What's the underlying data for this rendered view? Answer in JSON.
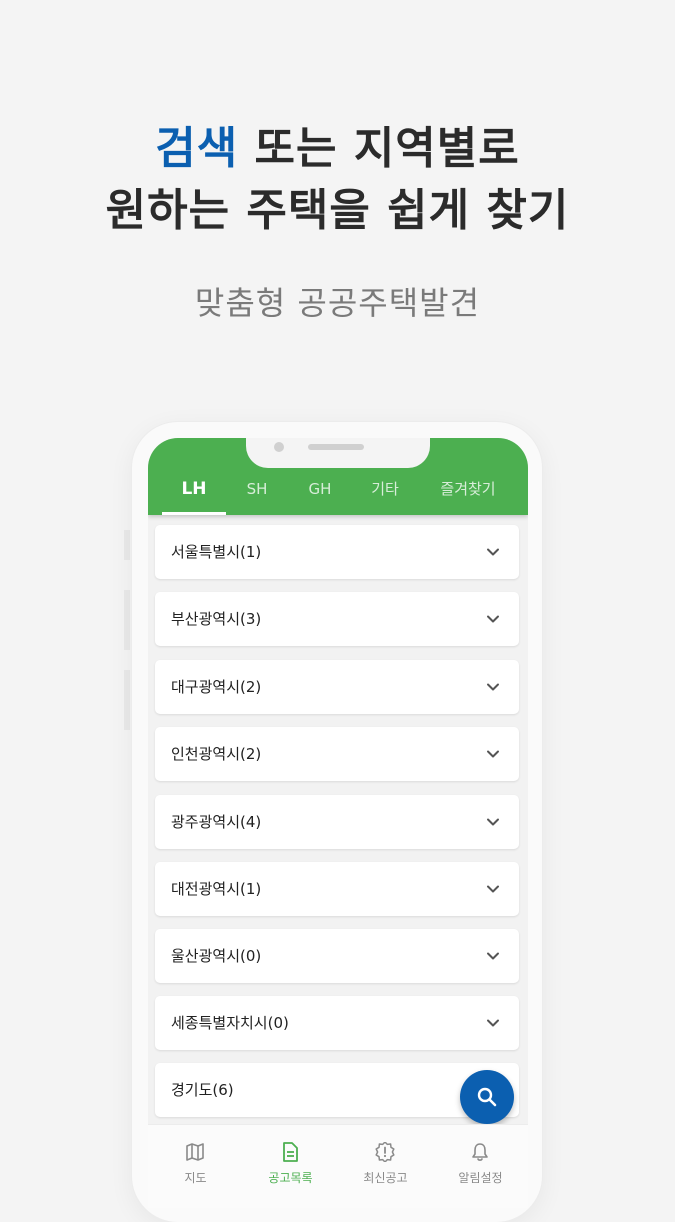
{
  "headline": {
    "line1_highlight": "검색",
    "line1_rest": " 또는 지역별로",
    "line2": "원하는 주택을 쉽게 찾기"
  },
  "subheadline": "맞춤형 공공주택발견",
  "colors": {
    "accent_green": "#4caf50",
    "accent_blue": "#0b5fb0"
  },
  "tabs": [
    {
      "label": "LH",
      "active": true
    },
    {
      "label": "SH",
      "active": false
    },
    {
      "label": "GH",
      "active": false
    },
    {
      "label": "기타",
      "active": false
    },
    {
      "label": "즐겨찾기",
      "active": false
    }
  ],
  "regions": [
    {
      "label": "서울특별시(1)"
    },
    {
      "label": "부산광역시(3)"
    },
    {
      "label": "대구광역시(2)"
    },
    {
      "label": "인천광역시(2)"
    },
    {
      "label": "광주광역시(4)"
    },
    {
      "label": "대전광역시(1)"
    },
    {
      "label": "울산광역시(0)"
    },
    {
      "label": "세종특별자치시(0)"
    },
    {
      "label": "경기도(6)"
    }
  ],
  "fab": {
    "icon": "search-icon"
  },
  "bottom_nav": [
    {
      "label": "지도",
      "icon": "map-icon",
      "active": false
    },
    {
      "label": "공고목록",
      "icon": "document-icon",
      "active": true
    },
    {
      "label": "최신공고",
      "icon": "alert-badge-icon",
      "active": false
    },
    {
      "label": "알림설정",
      "icon": "bell-icon",
      "active": false
    }
  ]
}
